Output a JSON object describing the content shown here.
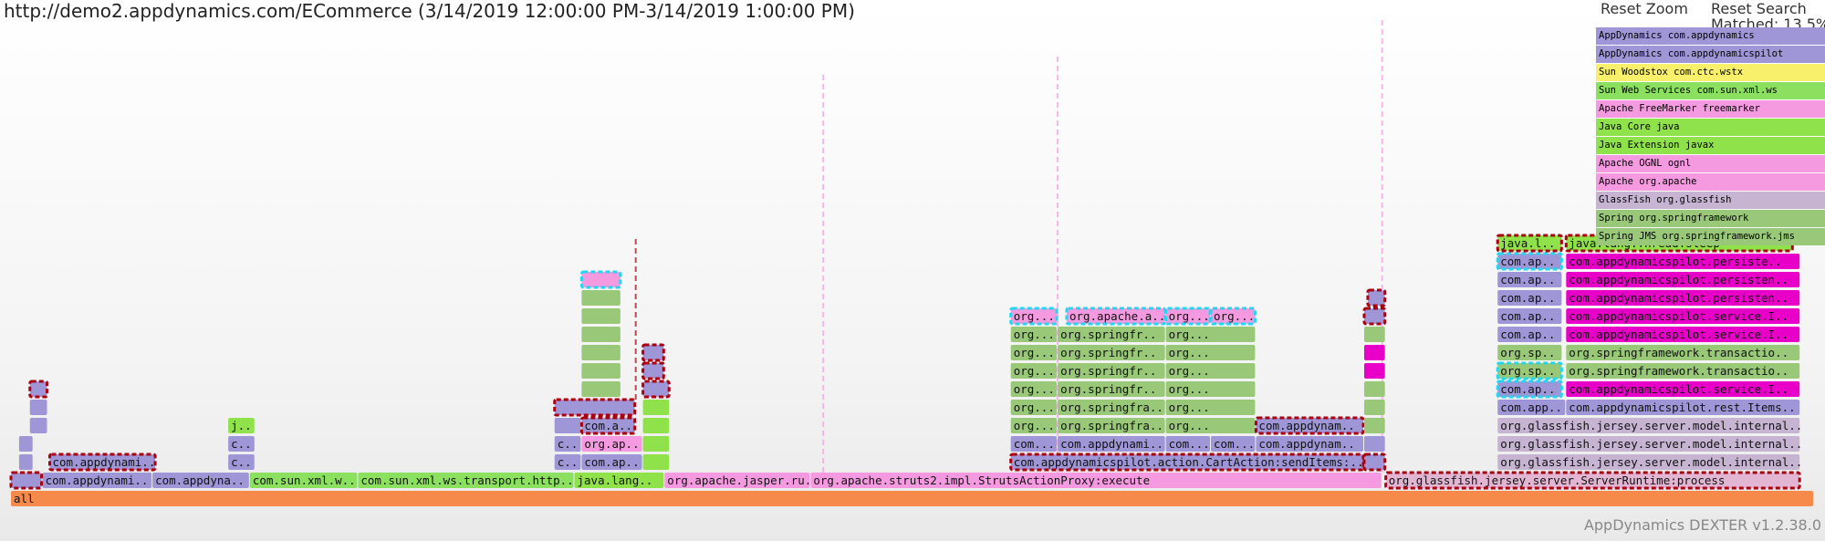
{
  "page": {
    "title": "http://demo2.appdynamics.com/ECommerce (3/14/2019 12:00:00 PM-3/14/2019 1:00:00 PM)",
    "reset_zoom": "Reset Zoom",
    "reset_search": "Reset Search",
    "matched": "Matched: 13.5%",
    "footer": "AppDynamics DEXTER v1.2.38.0"
  },
  "colors": {
    "appdynamics": "#9e96d6",
    "sun_woodstox": "#f8f06a",
    "sun_web_services": "#8be060",
    "freemarker": "#f59ae0",
    "java_core": "#8fe24a",
    "apache": "#f59ae0",
    "glassfish": "#c6b4d2",
    "spring": "#98c878",
    "match": "#e800c8",
    "root": "#f58a4a",
    "highlight_red": "#aa0010",
    "highlight_cyan": "#22d8f0"
  },
  "legend": [
    {
      "label": "AppDynamics com.appdynamics",
      "color": "#9e96d6"
    },
    {
      "label": "AppDynamics com.appdynamicspilot",
      "color": "#9e96d6"
    },
    {
      "label": "Sun Woodstox com.ctc.wstx",
      "color": "#f8f06a"
    },
    {
      "label": "Sun Web Services com.sun.xml.ws",
      "color": "#8be060"
    },
    {
      "label": "Apache FreeMarker freemarker",
      "color": "#f59ae0"
    },
    {
      "label": "Java Core java",
      "color": "#8fe24a"
    },
    {
      "label": "Java Extension javax",
      "color": "#8fe24a"
    },
    {
      "label": "Apache OGNL ognl",
      "color": "#f59ae0"
    },
    {
      "label": "Apache org.apache",
      "color": "#f59ae0"
    },
    {
      "label": "GlassFish org.glassfish",
      "color": "#c6b4d2"
    },
    {
      "label": "Spring org.springframework",
      "color": "#98c878"
    },
    {
      "label": "Spring JMS org.springframework.jms",
      "color": "#98c878"
    }
  ],
  "chart_data": {
    "type": "flamegraph",
    "frames": [
      {
        "label": "all",
        "depth": 0,
        "start": 0.0,
        "end": 1.0,
        "color": "#f58a4a"
      },
      {
        "label": "com.appdynami..",
        "depth": 1,
        "start": 0.0175,
        "end": 0.0785,
        "color": "#9e96d6"
      },
      {
        "label": "com.appdyna..",
        "depth": 1,
        "start": 0.0785,
        "end": 0.1325,
        "color": "#9e96d6"
      },
      {
        "label": "com.sun.xml.w..",
        "depth": 1,
        "start": 0.1325,
        "end": 0.1925,
        "color": "#8be060"
      },
      {
        "label": "com.sun.xml.ws.transport.http..",
        "depth": 1,
        "start": 0.1925,
        "end": 0.3125,
        "color": "#8be060"
      },
      {
        "label": "java.lang..",
        "depth": 1,
        "start": 0.3125,
        "end": 0.3625,
        "color": "#8fe24a"
      },
      {
        "label": "org.apache.jasper.ru..",
        "depth": 1,
        "start": 0.3625,
        "end": 0.4435,
        "color": "#f59ae0"
      },
      {
        "label": "org.apache.struts2.impl.StrutsActionProxy:execute",
        "depth": 1,
        "start": 0.4435,
        "end": 0.7605,
        "color": "#f59ae0"
      },
      {
        "label": "org.glassfish.jersey.server.ServerRuntime:process",
        "depth": 1,
        "start": 0.7625,
        "end": 0.9925,
        "color": "#e2b6d2",
        "outline": "#aa0010"
      },
      {
        "label": "",
        "depth": 1,
        "start": 0.0,
        "end": 0.0175,
        "color": "#9e96d6",
        "outline": "#aa0010"
      },
      {
        "label": "com.appdynami..",
        "depth": 2,
        "start": 0.0215,
        "end": 0.0805,
        "color": "#9e96d6",
        "outline": "#aa0010"
      },
      {
        "label": "",
        "depth": 2,
        "start": 0.0045,
        "end": 0.0125,
        "color": "#9e96d6"
      },
      {
        "label": "",
        "depth": 3,
        "start": 0.0045,
        "end": 0.0125,
        "color": "#9e96d6"
      },
      {
        "label": "",
        "depth": 4,
        "start": 0.0105,
        "end": 0.0205,
        "color": "#9e96d6"
      },
      {
        "label": "",
        "depth": 5,
        "start": 0.0105,
        "end": 0.0205,
        "color": "#9e96d6"
      },
      {
        "label": "",
        "depth": 6,
        "start": 0.0105,
        "end": 0.0205,
        "color": "#9e96d6",
        "outline": "#aa0010"
      },
      {
        "label": "c..",
        "depth": 2,
        "start": 0.1205,
        "end": 0.1355,
        "color": "#9e96d6"
      },
      {
        "label": "c..",
        "depth": 3,
        "start": 0.1205,
        "end": 0.1355,
        "color": "#9e96d6"
      },
      {
        "label": "j..",
        "depth": 4,
        "start": 0.1205,
        "end": 0.1355,
        "color": "#8fe24a"
      },
      {
        "label": "c..",
        "depth": 2,
        "start": 0.3015,
        "end": 0.3165,
        "color": "#9e96d6"
      },
      {
        "label": "com.ap..",
        "depth": 2,
        "start": 0.3165,
        "end": 0.3505,
        "color": "#9e96d6"
      },
      {
        "label": "c..",
        "depth": 3,
        "start": 0.3015,
        "end": 0.3165,
        "color": "#9e96d6"
      },
      {
        "label": "org.ap..",
        "depth": 3,
        "start": 0.3165,
        "end": 0.3505,
        "color": "#f59ae0"
      },
      {
        "label": "",
        "depth": 4,
        "start": 0.3015,
        "end": 0.3165,
        "color": "#9e96d6"
      },
      {
        "label": "com.a..",
        "depth": 4,
        "start": 0.3165,
        "end": 0.3465,
        "color": "#9e96d6",
        "outline": "#aa0010"
      },
      {
        "label": "",
        "depth": 5,
        "start": 0.3015,
        "end": 0.3465,
        "color": "#9e96d6",
        "outline": "#aa0010"
      },
      {
        "label": "",
        "depth": 6,
        "start": 0.3165,
        "end": 0.3385,
        "color": "#98c878"
      },
      {
        "label": "",
        "depth": 7,
        "start": 0.3165,
        "end": 0.3385,
        "color": "#98c878"
      },
      {
        "label": "",
        "depth": 8,
        "start": 0.3165,
        "end": 0.3385,
        "color": "#98c878"
      },
      {
        "label": "",
        "depth": 9,
        "start": 0.3165,
        "end": 0.3385,
        "color": "#98c878"
      },
      {
        "label": "",
        "depth": 10,
        "start": 0.3165,
        "end": 0.3385,
        "color": "#98c878"
      },
      {
        "label": "",
        "depth": 11,
        "start": 0.3165,
        "end": 0.3385,
        "color": "#98c878"
      },
      {
        "label": "",
        "depth": 12,
        "start": 0.3165,
        "end": 0.3385,
        "color": "#f59ae0",
        "outline": "#22d8f0"
      },
      {
        "label": "",
        "depth": 2,
        "start": 0.3505,
        "end": 0.3655,
        "color": "#8fe24a"
      },
      {
        "label": "",
        "depth": 3,
        "start": 0.3505,
        "end": 0.3655,
        "color": "#8fe24a"
      },
      {
        "label": "",
        "depth": 4,
        "start": 0.3505,
        "end": 0.3655,
        "color": "#8fe24a"
      },
      {
        "label": "",
        "depth": 5,
        "start": 0.3505,
        "end": 0.3655,
        "color": "#8fe24a"
      },
      {
        "label": "",
        "depth": 6,
        "start": 0.3505,
        "end": 0.3655,
        "color": "#9e96d6",
        "outline": "#aa0010"
      },
      {
        "label": "",
        "depth": 7,
        "start": 0.3505,
        "end": 0.3625,
        "color": "#9e96d6",
        "outline": "#aa0010"
      },
      {
        "label": "",
        "depth": 8,
        "start": 0.3505,
        "end": 0.3625,
        "color": "#9e96d6",
        "outline": "#aa0010"
      },
      {
        "label": "com.appdynamicspilot.action.CartAction:sendItems:..",
        "depth": 2,
        "start": 0.5545,
        "end": 0.7505,
        "color": "#9e96d6",
        "outline": "#aa0010"
      },
      {
        "label": "com...",
        "depth": 3,
        "start": 0.5545,
        "end": 0.5805,
        "color": "#9e96d6"
      },
      {
        "label": "com.appdynami..",
        "depth": 3,
        "start": 0.5805,
        "end": 0.6405,
        "color": "#9e96d6"
      },
      {
        "label": "com...",
        "depth": 3,
        "start": 0.6405,
        "end": 0.6655,
        "color": "#9e96d6"
      },
      {
        "label": "com...",
        "depth": 3,
        "start": 0.6655,
        "end": 0.6905,
        "color": "#9e96d6"
      },
      {
        "label": "com.appdynam..",
        "depth": 3,
        "start": 0.6905,
        "end": 0.7505,
        "color": "#9e96d6"
      },
      {
        "label": "org...",
        "depth": 4,
        "start": 0.5545,
        "end": 0.5805,
        "color": "#98c878"
      },
      {
        "label": "org.springfra..",
        "depth": 4,
        "start": 0.5805,
        "end": 0.6405,
        "color": "#98c878"
      },
      {
        "label": "org...",
        "depth": 4,
        "start": 0.6405,
        "end": 0.6905,
        "color": "#98c878"
      },
      {
        "label": "com.appdynam..",
        "depth": 4,
        "start": 0.6905,
        "end": 0.7505,
        "color": "#9e96d6",
        "outline": "#aa0010"
      },
      {
        "label": "org...",
        "depth": 5,
        "start": 0.5545,
        "end": 0.5805,
        "color": "#98c878"
      },
      {
        "label": "org.springfra..",
        "depth": 5,
        "start": 0.5805,
        "end": 0.6405,
        "color": "#98c878"
      },
      {
        "label": "org...",
        "depth": 5,
        "start": 0.6405,
        "end": 0.6905,
        "color": "#98c878"
      },
      {
        "label": "org...",
        "depth": 6,
        "start": 0.5545,
        "end": 0.5805,
        "color": "#98c878"
      },
      {
        "label": "org.springfr..",
        "depth": 6,
        "start": 0.5805,
        "end": 0.6405,
        "color": "#98c878"
      },
      {
        "label": "org...",
        "depth": 6,
        "start": 0.6405,
        "end": 0.6905,
        "color": "#98c878"
      },
      {
        "label": "org...",
        "depth": 7,
        "start": 0.5545,
        "end": 0.5805,
        "color": "#98c878"
      },
      {
        "label": "org.springfr..",
        "depth": 7,
        "start": 0.5805,
        "end": 0.6405,
        "color": "#98c878"
      },
      {
        "label": "org...",
        "depth": 7,
        "start": 0.6405,
        "end": 0.6905,
        "color": "#98c878"
      },
      {
        "label": "org...",
        "depth": 8,
        "start": 0.5545,
        "end": 0.5805,
        "color": "#98c878"
      },
      {
        "label": "org.springfr..",
        "depth": 8,
        "start": 0.5805,
        "end": 0.6405,
        "color": "#98c878"
      },
      {
        "label": "org...",
        "depth": 8,
        "start": 0.6405,
        "end": 0.6905,
        "color": "#98c878"
      },
      {
        "label": "org...",
        "depth": 9,
        "start": 0.5545,
        "end": 0.5805,
        "color": "#98c878"
      },
      {
        "label": "org.springfr..",
        "depth": 9,
        "start": 0.5805,
        "end": 0.6405,
        "color": "#98c878"
      },
      {
        "label": "org...",
        "depth": 9,
        "start": 0.6405,
        "end": 0.6905,
        "color": "#98c878"
      },
      {
        "label": "org...",
        "depth": 10,
        "start": 0.5545,
        "end": 0.5805,
        "color": "#f59ae0",
        "outline": "#22d8f0"
      },
      {
        "label": "org.apache.a..",
        "depth": 10,
        "start": 0.5855,
        "end": 0.6405,
        "color": "#f59ae0",
        "outline": "#22d8f0"
      },
      {
        "label": "org...",
        "depth": 10,
        "start": 0.6405,
        "end": 0.6655,
        "color": "#f59ae0",
        "outline": "#22d8f0"
      },
      {
        "label": "org...",
        "depth": 10,
        "start": 0.6655,
        "end": 0.6905,
        "color": "#f59ae0",
        "outline": "#22d8f0"
      },
      {
        "label": "",
        "depth": 2,
        "start": 0.7505,
        "end": 0.7625,
        "color": "#9e96d6",
        "outline": "#aa0010"
      },
      {
        "label": "",
        "depth": 3,
        "start": 0.7505,
        "end": 0.7625,
        "color": "#9e96d6"
      },
      {
        "label": "",
        "depth": 4,
        "start": 0.7505,
        "end": 0.7625,
        "color": "#98c878"
      },
      {
        "label": "",
        "depth": 5,
        "start": 0.7505,
        "end": 0.7625,
        "color": "#98c878"
      },
      {
        "label": "",
        "depth": 6,
        "start": 0.7505,
        "end": 0.7625,
        "color": "#98c878"
      },
      {
        "label": "",
        "depth": 7,
        "start": 0.7505,
        "end": 0.7625,
        "color": "#e800c8"
      },
      {
        "label": "",
        "depth": 8,
        "start": 0.7505,
        "end": 0.7625,
        "color": "#e800c8"
      },
      {
        "label": "",
        "depth": 9,
        "start": 0.7505,
        "end": 0.7625,
        "color": "#98c878"
      },
      {
        "label": "",
        "depth": 10,
        "start": 0.7505,
        "end": 0.7625,
        "color": "#9e96d6",
        "outline": "#aa0010"
      },
      {
        "label": "",
        "depth": 11,
        "start": 0.7525,
        "end": 0.7625,
        "color": "#9e96d6",
        "outline": "#aa0010"
      },
      {
        "label": "org.glassfish.jersey.server.model.internal..",
        "depth": 2,
        "start": 0.8245,
        "end": 0.9925,
        "color": "#c6b4d2"
      },
      {
        "label": "org.glassfish.jersey.server.model.internal..",
        "depth": 3,
        "start": 0.8245,
        "end": 0.9925,
        "color": "#c6b4d2"
      },
      {
        "label": "org.glassfish.jersey.server.model.internal..",
        "depth": 4,
        "start": 0.8245,
        "end": 0.9925,
        "color": "#c6b4d2"
      },
      {
        "label": "com.app..",
        "depth": 5,
        "start": 0.8245,
        "end": 0.8625,
        "color": "#9e96d6"
      },
      {
        "label": "com.appdynamicspilot.rest.Items..",
        "depth": 5,
        "start": 0.8625,
        "end": 0.9925,
        "color": "#9e96d6"
      },
      {
        "label": "com.ap..",
        "depth": 6,
        "start": 0.8245,
        "end": 0.8605,
        "color": "#9e96d6",
        "outline": "#22d8f0"
      },
      {
        "label": "com.appdynamicspilot.service.I..",
        "depth": 6,
        "start": 0.8625,
        "end": 0.9925,
        "color": "#e800c8"
      },
      {
        "label": "org.sp..",
        "depth": 7,
        "start": 0.8245,
        "end": 0.8605,
        "color": "#98c878",
        "outline": "#22d8f0"
      },
      {
        "label": "org.springframework.transactio..",
        "depth": 7,
        "start": 0.8625,
        "end": 0.9925,
        "color": "#98c878"
      },
      {
        "label": "org.sp..",
        "depth": 8,
        "start": 0.8245,
        "end": 0.8605,
        "color": "#98c878"
      },
      {
        "label": "org.springframework.transactio..",
        "depth": 8,
        "start": 0.8625,
        "end": 0.9925,
        "color": "#98c878"
      },
      {
        "label": "com.ap..",
        "depth": 9,
        "start": 0.8245,
        "end": 0.8605,
        "color": "#9e96d6"
      },
      {
        "label": "com.appdynamicspilot.service.I..",
        "depth": 9,
        "start": 0.8625,
        "end": 0.9925,
        "color": "#e800c8"
      },
      {
        "label": "com.ap..",
        "depth": 10,
        "start": 0.8245,
        "end": 0.8605,
        "color": "#9e96d6"
      },
      {
        "label": "com.appdynamicspilot.service.I..",
        "depth": 10,
        "start": 0.8625,
        "end": 0.9925,
        "color": "#e800c8"
      },
      {
        "label": "com.ap..",
        "depth": 11,
        "start": 0.8245,
        "end": 0.8605,
        "color": "#9e96d6"
      },
      {
        "label": "com.appdynamicspilot.persisten..",
        "depth": 11,
        "start": 0.8625,
        "end": 0.9925,
        "color": "#e800c8"
      },
      {
        "label": "com.ap..",
        "depth": 12,
        "start": 0.8245,
        "end": 0.8605,
        "color": "#9e96d6"
      },
      {
        "label": "com.appdynamicspilot.persisten..",
        "depth": 12,
        "start": 0.8625,
        "end": 0.9925,
        "color": "#e800c8"
      },
      {
        "label": "com.ap..",
        "depth": 13,
        "start": 0.8245,
        "end": 0.8605,
        "color": "#9e96d6",
        "outline": "#22d8f0"
      },
      {
        "label": "com.appdynamicspilot.persiste..",
        "depth": 13,
        "start": 0.8625,
        "end": 0.9925,
        "color": "#e800c8"
      },
      {
        "label": "java.l..",
        "depth": 14,
        "start": 0.8245,
        "end": 0.8605,
        "color": "#8fe24a",
        "outline": "#aa0010"
      },
      {
        "label": "java.lang.Thread:sleep",
        "depth": 14,
        "start": 0.8625,
        "end": 0.9885,
        "color": "#8fe24a",
        "outline": "#aa0010"
      }
    ],
    "spikes": [
      {
        "x": 0.4505,
        "from_depth": 1,
        "to_depth": 23,
        "color": "#f59ae0"
      },
      {
        "x": 0.5805,
        "from_depth": 1,
        "to_depth": 24,
        "color": "#f59ae0"
      },
      {
        "x": 0.7605,
        "from_depth": 1,
        "to_depth": 26,
        "color": "#f59ae0"
      },
      {
        "x": 0.3465,
        "from_depth": 5,
        "to_depth": 14,
        "color": "#aa0010"
      }
    ]
  }
}
